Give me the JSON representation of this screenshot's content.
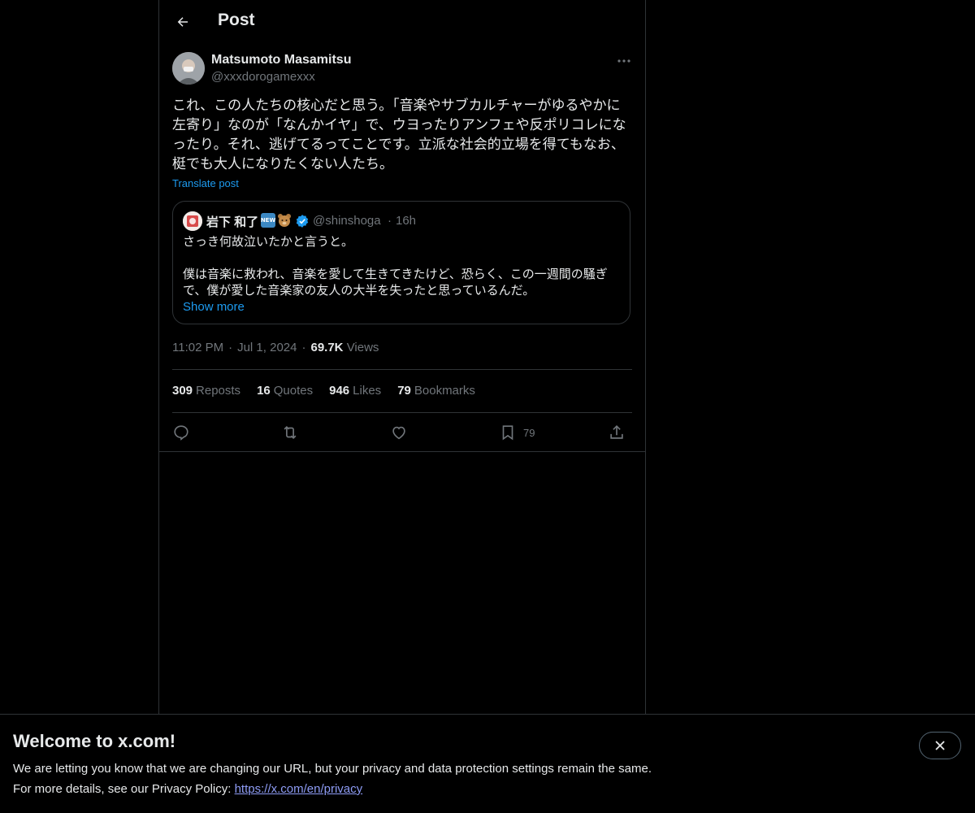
{
  "header": {
    "title": "Post",
    "back_icon": "arrow-left-icon"
  },
  "post": {
    "author_name": "Matsumoto Masamitsu",
    "author_handle": "@xxxdorogamexxx",
    "text": "これ、この人たちの核心だと思う。「音楽やサブカルチャーがゆるやかに\n左寄り」なのが「なんかイヤ」で、ウヨったりアンフェや反ポリコレにな\nったり。それ、逃げてるってことです。立派な社会的立場を得てもなお、\n梃でも大人になりたくない人たち。",
    "translate_label": "Translate post",
    "time": "11:02 PM",
    "date": "Jul 1, 2024",
    "views_count": "69.7K",
    "views_label": "Views",
    "dot": "·"
  },
  "quote": {
    "name": "岩下 和了",
    "badge_new": "NEW",
    "handle": "@shinshoga",
    "dot": "·",
    "time": "16h",
    "text": "さっき何故泣いたかと言うと。\n\n僕は音楽に救われ、音楽を愛して生きてきたけど、恐らく、この一週間の騒ぎ\nで、僕が愛した音楽家の友人の大半を失ったと思っているんだ。",
    "show_more": "Show more"
  },
  "stats": [
    {
      "num": "309",
      "label": "Reposts"
    },
    {
      "num": "16",
      "label": "Quotes"
    },
    {
      "num": "946",
      "label": "Likes"
    },
    {
      "num": "79",
      "label": "Bookmarks"
    }
  ],
  "actions": {
    "bookmark_count": "79"
  },
  "banner": {
    "title": "Welcome to x.com!",
    "line1": "We are letting you know that we are changing our URL, but your privacy and data protection settings remain the same.",
    "line2_prefix": "For more details, see our Privacy Policy: ",
    "link": "https://x.com/en/privacy"
  },
  "colors": {
    "accent": "#1d9bf0",
    "muted": "#71767b",
    "border": "#2f3336",
    "link": "#8e9cf5"
  }
}
